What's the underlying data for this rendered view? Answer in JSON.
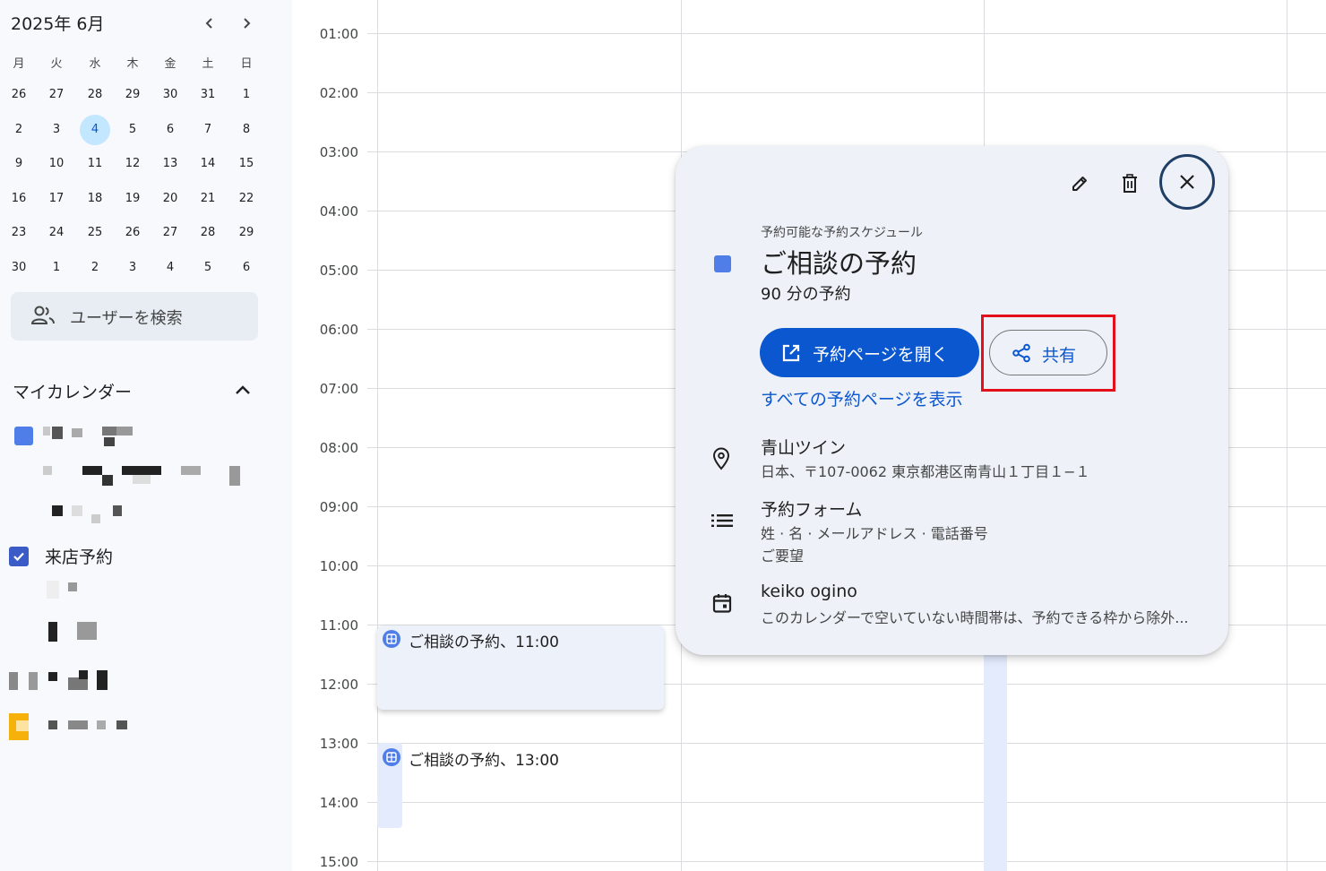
{
  "mini_calendar": {
    "title": "2025年 6月",
    "weekdays": [
      "月",
      "火",
      "水",
      "木",
      "金",
      "土",
      "日"
    ],
    "weeks": [
      [
        "26",
        "27",
        "28",
        "29",
        "30",
        "31",
        "1"
      ],
      [
        "2",
        "3",
        "4",
        "5",
        "6",
        "7",
        "8"
      ],
      [
        "9",
        "10",
        "11",
        "12",
        "13",
        "14",
        "15"
      ],
      [
        "16",
        "17",
        "18",
        "19",
        "20",
        "21",
        "22"
      ],
      [
        "23",
        "24",
        "25",
        "26",
        "27",
        "28",
        "29"
      ],
      [
        "30",
        "1",
        "2",
        "3",
        "4",
        "5",
        "6"
      ]
    ],
    "today": "4"
  },
  "search_users": {
    "label": "ユーザーを検索"
  },
  "my_calendars": {
    "label": "マイカレンダー",
    "items": [
      {
        "name": "",
        "color": "#4f7ee8",
        "checked": false
      },
      {
        "name": "来店予約",
        "color": "#3b5bc6",
        "checked": true
      }
    ]
  },
  "time_labels": [
    "01:00",
    "02:00",
    "03:00",
    "04:00",
    "05:00",
    "06:00",
    "07:00",
    "08:00",
    "09:00",
    "10:00",
    "11:00",
    "12:00",
    "13:00",
    "14:00",
    "15:00"
  ],
  "events": [
    {
      "label": "ご相談の予約、11:00"
    },
    {
      "label": "ご相談の予約、13:00"
    }
  ],
  "popup": {
    "subtitle": "予約可能な予約スケジュール",
    "title": "ご相談の予約",
    "duration": "90 分の予約",
    "open_button": "予約ページを開く",
    "share_button": "共有",
    "all_pages_link": "すべての予約ページを表示",
    "location": {
      "name": "青山ツイン",
      "address": "日本、〒107-0062 東京都港区南青山１丁目１−１"
    },
    "form": {
      "title": "予約フォーム",
      "fields": "姓 · 名 · メールアドレス · 電話番号",
      "extra": "ご要望"
    },
    "calendar": {
      "owner": "keiko ogino",
      "note": "このカレンダーで空いていない時間帯は、予約できる枠から除外..."
    }
  },
  "colors": {
    "accent": "#0b57d0",
    "today_bg": "#c2e7ff",
    "event": "#4f7ee8",
    "highlight": "#e3101c"
  }
}
